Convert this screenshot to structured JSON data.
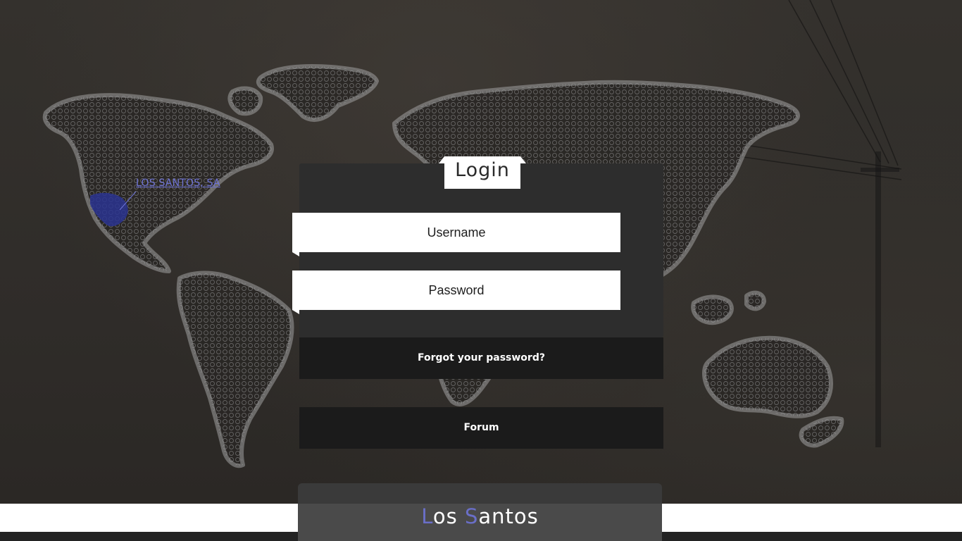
{
  "map": {
    "location_label": "LOS SANTOS, SA",
    "marker_color": "#2a3490"
  },
  "login": {
    "title": "Login",
    "username_placeholder": "Username",
    "password_placeholder": "Password",
    "username_value": "",
    "password_value": "",
    "forgot_label": "Forgot your password?",
    "forum_label": "Forum"
  },
  "brand": {
    "first_initial": "L",
    "first_rest": "os ",
    "second_initial": "S",
    "second_rest": "antos",
    "accent_color": "#6a6fc8"
  }
}
